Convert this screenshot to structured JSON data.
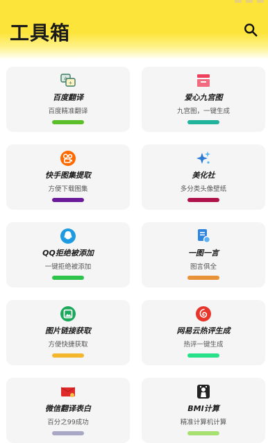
{
  "header": {
    "title": "工具箱",
    "search_icon": "search-icon"
  },
  "tools": [
    {
      "name": "百度翻译",
      "desc": "百度精准翻译",
      "icon": "translate-icon",
      "bar_color": "#5cbf2a"
    },
    {
      "name": "爱心九宫图",
      "desc": "九宫图，一键生成",
      "icon": "nine-grid-icon",
      "bar_color": "#22b39c"
    },
    {
      "name": "快手图集提取",
      "desc": "方便下载图集",
      "icon": "kuaishou-icon",
      "bar_color": "#6a1b9a"
    },
    {
      "name": "美化社",
      "desc": "多分类头像壁纸",
      "icon": "sparkle-icon",
      "bar_color": "#b0134a"
    },
    {
      "name": "QQ拒绝被添加",
      "desc": "一键拒绝被添加",
      "icon": "qq-icon",
      "bar_color": "#2ec34a"
    },
    {
      "name": "一图一言",
      "desc": "图言俱全",
      "icon": "image-quote-icon",
      "bar_color": "#e8923a"
    },
    {
      "name": "图片链接获取",
      "desc": "方便快捷获取",
      "icon": "image-link-icon",
      "bar_color": "#f3b72e"
    },
    {
      "name": "网易云热评生成",
      "desc": "热评一键生成",
      "icon": "netease-music-icon",
      "bar_color": "#26e08a"
    },
    {
      "name": "微信翻译表白",
      "desc": "百分之99成功",
      "icon": "red-envelope-icon",
      "bar_color": "#a9a7c6"
    },
    {
      "name": "BMI计算",
      "desc": "精准计算机计算",
      "icon": "bmi-scale-icon",
      "bar_color": "#a6e070"
    }
  ]
}
